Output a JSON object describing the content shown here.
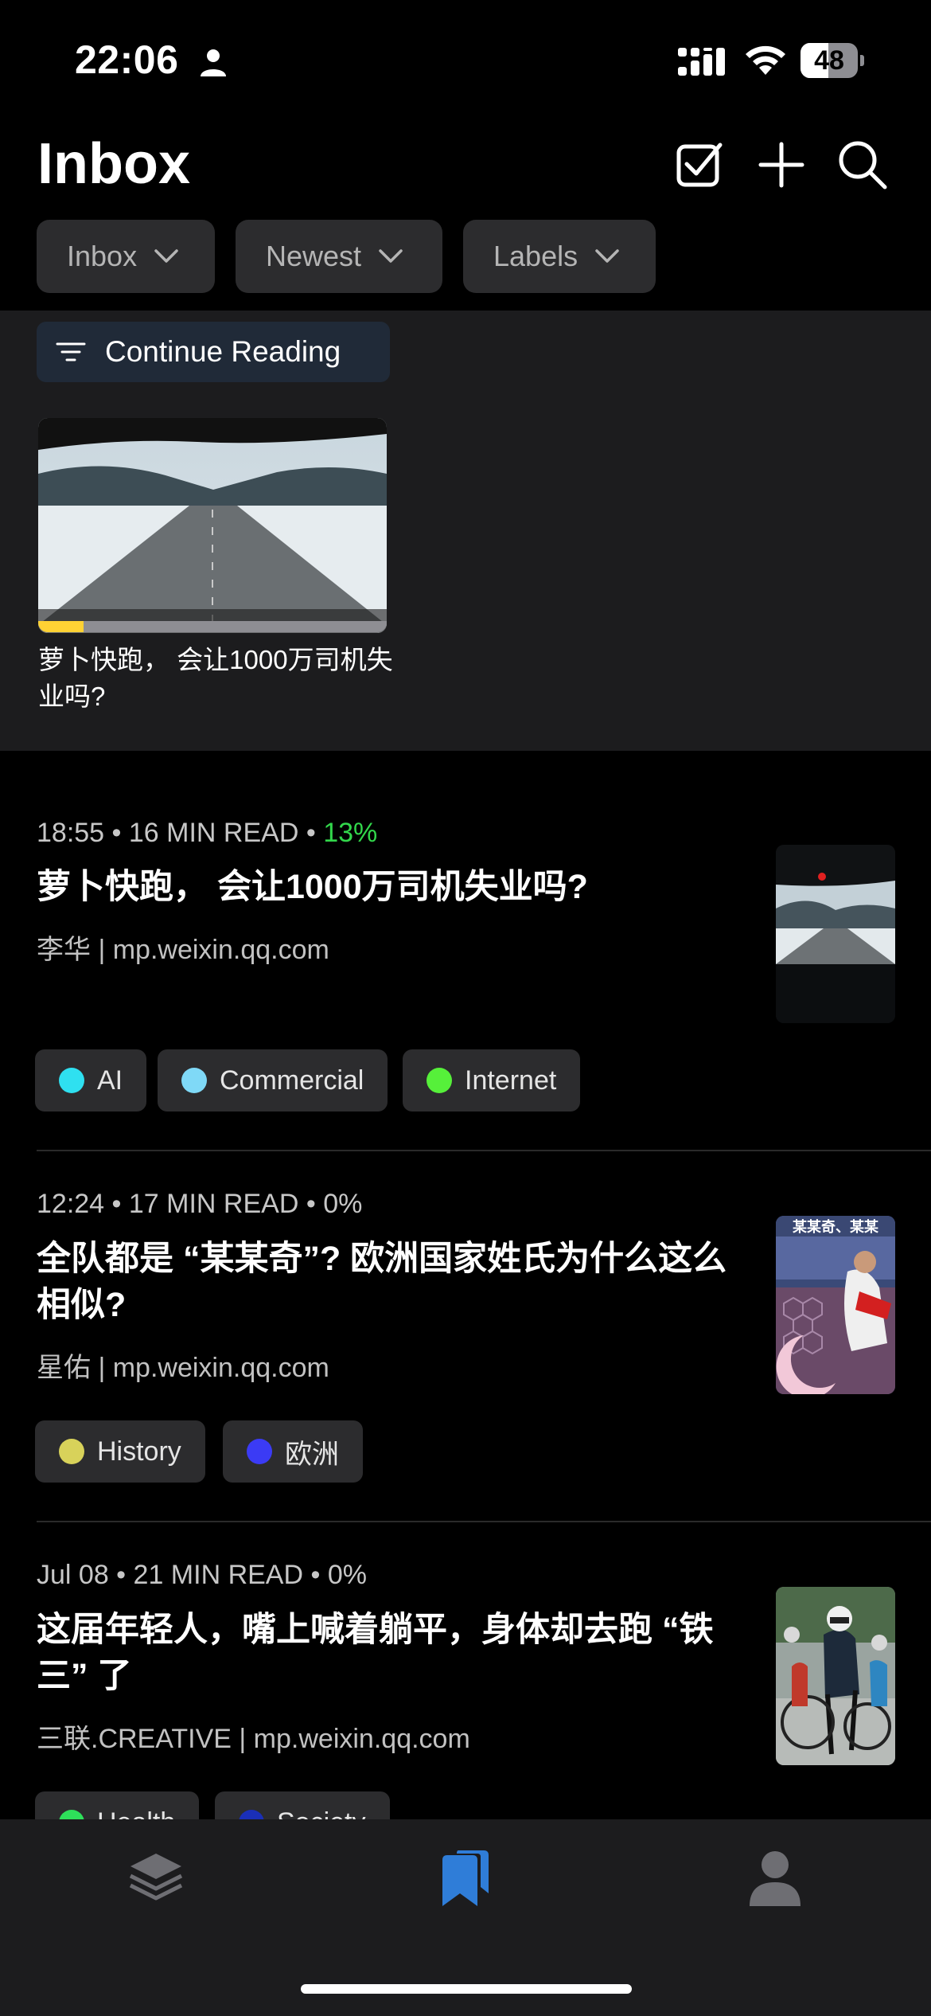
{
  "status_bar": {
    "time": "22:06",
    "battery": "48",
    "battery_level": 0.48
  },
  "header": {
    "title": "Inbox",
    "icons": [
      "checkbox-icon",
      "plus-icon",
      "search-icon"
    ]
  },
  "filters": [
    {
      "label": "Inbox"
    },
    {
      "label": "Newest"
    },
    {
      "label": "Labels"
    }
  ],
  "continue_reading": {
    "label": "Continue Reading",
    "item": {
      "title": "萝卜快跑， 会让1000万司机失业吗?",
      "progress": 0.13
    }
  },
  "articles": [
    {
      "time": "18:55",
      "read_time": "16 MIN READ",
      "percent": "13%",
      "title": "萝卜快跑， 会让1000万司机失业吗?",
      "source": "李华 | mp.weixin.qq.com",
      "labels": [
        {
          "name": "AI",
          "color": "#2fe0f0"
        },
        {
          "name": "Commercial",
          "color": "#7fd9f7"
        },
        {
          "name": "Internet",
          "color": "#56f03a"
        }
      ]
    },
    {
      "time": "12:24",
      "read_time": "17 MIN READ",
      "percent": "0%",
      "title": "全队都是 “某某奇”? 欧洲国家姓氏为什么这么相似?",
      "source": "星佑 | mp.weixin.qq.com",
      "thumb_text": "某某奇、某某",
      "labels": [
        {
          "name": "History",
          "color": "#d8d25a"
        },
        {
          "name": "欧洲",
          "color": "#3b3bf5"
        }
      ]
    },
    {
      "time": "Jul 08",
      "read_time": "21 MIN READ",
      "percent": "0%",
      "title": "这届年轻人，嘴上喊着躺平，身体却去跑 “铁三” 了",
      "source": "三联.CREATIVE | mp.weixin.qq.com",
      "labels": [
        {
          "name": "Health",
          "color": "#2ee05a"
        },
        {
          "name": "Society",
          "color": "#1a2fb8"
        }
      ]
    }
  ],
  "tab_bar": {
    "accent": "#2f7dd8",
    "tabs": [
      "library-icon",
      "bookmarks-icon",
      "profile-icon"
    ]
  }
}
